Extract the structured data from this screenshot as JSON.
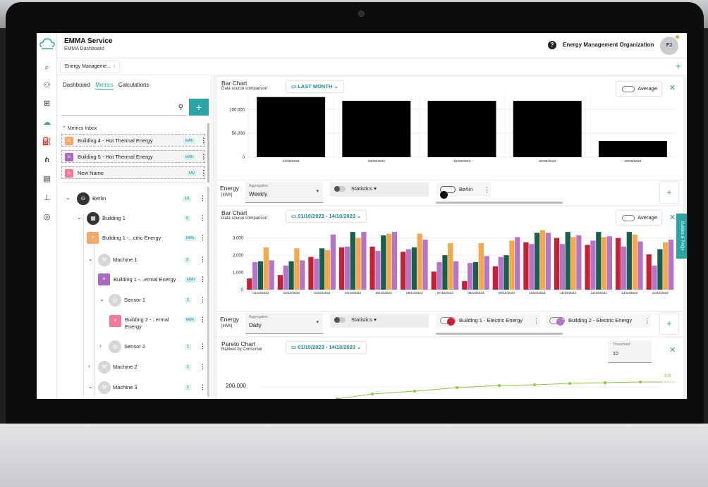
{
  "app": {
    "title": "EMMA Service",
    "subtitle": "EMMA Dashboard",
    "org": "Energy Management Organization",
    "avatar": "FJ",
    "help": "?"
  },
  "tab": {
    "label": "Energy Manageme..."
  },
  "subtabs": [
    "Dashboard",
    "Metrics",
    "Calculations"
  ],
  "inbox": {
    "header": "Metrics Inbox",
    "items": [
      {
        "label": "Building 4 - Hot Thermal Energy",
        "unit": "kWh",
        "color": "orange"
      },
      {
        "label": "Building 5 - Hot Thermal Energy",
        "unit": "kWh",
        "color": "purple"
      },
      {
        "label": "New Name",
        "unit": "kW",
        "color": "pink"
      }
    ]
  },
  "tree": {
    "berlin": {
      "label": "Berlin",
      "badge": "10"
    },
    "building1": {
      "label": "Building 1",
      "badge": "6"
    },
    "b1_electric": {
      "label": "Building 1 -...ctric Energy",
      "unit": "kWh"
    },
    "machine1": {
      "label": "Machine 1",
      "badge": "3"
    },
    "b1_thermal": {
      "label": "Building 1 -...ermal Energy",
      "unit": "kWh"
    },
    "sensor1": {
      "label": "Sensor 1",
      "badge": "1"
    },
    "b2_thermal_a": "Building 2 -...ermal",
    "b2_thermal_b": "Energy",
    "b2_unit": "kWh",
    "sensor2": {
      "label": "Sensor 2",
      "badge": "1"
    },
    "machine2": {
      "label": "Machine 2",
      "badge": "1"
    },
    "machine3": {
      "label": "Machine 3",
      "badge": "1"
    }
  },
  "bar1": {
    "title": "Bar Chart",
    "subtitle": "Data source comparison",
    "period": "LAST MONTH",
    "average": "Average",
    "energy": "Energy",
    "unit": "[kWh]",
    "agg_label": "Aggregation",
    "agg_value": "Weekly",
    "statistics": "Statistics",
    "series": "Berlin"
  },
  "bar2": {
    "title": "Bar Chart",
    "subtitle": "Data source comparison",
    "period": "01/10/2023 - 14/10/2023",
    "average": "Average",
    "energy": "Energy",
    "unit": "[kWh]",
    "agg_label": "Aggregation",
    "agg_value": "Daily",
    "statistics": "Statistics",
    "series1": "Building 1 - Electric Energy",
    "series2": "Building 2 - Electric Energy"
  },
  "pareto": {
    "title": "Pareto Chart",
    "subtitle": "Ranked by Consumer",
    "period": "01/10/2023 - 14/10/2023",
    "threshold_label": "Threshold",
    "threshold_value": "10",
    "ytick": "200,000",
    "right_tick": "100"
  },
  "guides": "Guides & FAQs",
  "colors": {
    "accent": "#2aa4a5",
    "red": "#c62032",
    "orange": "#f5a84a",
    "green": "#16604f",
    "purple": "#b574c8"
  },
  "chart_data": [
    {
      "type": "bar",
      "title": "Bar Chart",
      "subtitle": "Data source comparison",
      "categories": [
        "01/09/2023",
        "08/09/2023",
        "15/09/2023",
        "22/09/2023",
        "29/09/2023"
      ],
      "yticks": [
        "100,000",
        "50,000",
        "0"
      ],
      "ylim": [
        0,
        130000
      ],
      "series": [
        {
          "name": "Berlin",
          "values": [
            126000,
            118000,
            118000,
            118000,
            34000
          ]
        }
      ]
    },
    {
      "type": "bar",
      "title": "Bar Chart",
      "subtitle": "Data source comparison",
      "categories": [
        "01/10/2023",
        "02/10/2023",
        "03/10/2023",
        "04/10/2023",
        "05/10/2023",
        "06/10/2023",
        "07/10/2023",
        "08/10/2023",
        "09/10/2023",
        "10/10/2023",
        "11/10/2023",
        "12/10/2023",
        "13/10/2023",
        "14/10/2023"
      ],
      "yticks": [
        "3,000",
        "2,000",
        "1,000",
        "0"
      ],
      "ylim": [
        0,
        3600
      ],
      "series": [
        {
          "values": [
            650,
            850,
            1900,
            2450,
            2500,
            2200,
            1050,
            500,
            1350,
            2750,
            3000,
            2600,
            3000,
            2050
          ]
        },
        {
          "values": [
            1600,
            1400,
            1800,
            2500,
            2250,
            2350,
            1600,
            1550,
            1900,
            2650,
            2650,
            2850,
            2500,
            1400
          ]
        },
        {
          "values": [
            1650,
            1650,
            2400,
            3350,
            3150,
            2450,
            2000,
            1600,
            2000,
            3300,
            3350,
            3350,
            3350,
            2350
          ]
        },
        {
          "values": [
            2450,
            2400,
            2300,
            3000,
            3250,
            3250,
            2700,
            2700,
            2850,
            3450,
            3050,
            3050,
            3200,
            2750
          ]
        },
        {
          "values": [
            1700,
            1700,
            3200,
            3350,
            3350,
            2900,
            1650,
            1950,
            3050,
            3300,
            3150,
            3100,
            2800,
            2900
          ]
        }
      ]
    }
  ]
}
